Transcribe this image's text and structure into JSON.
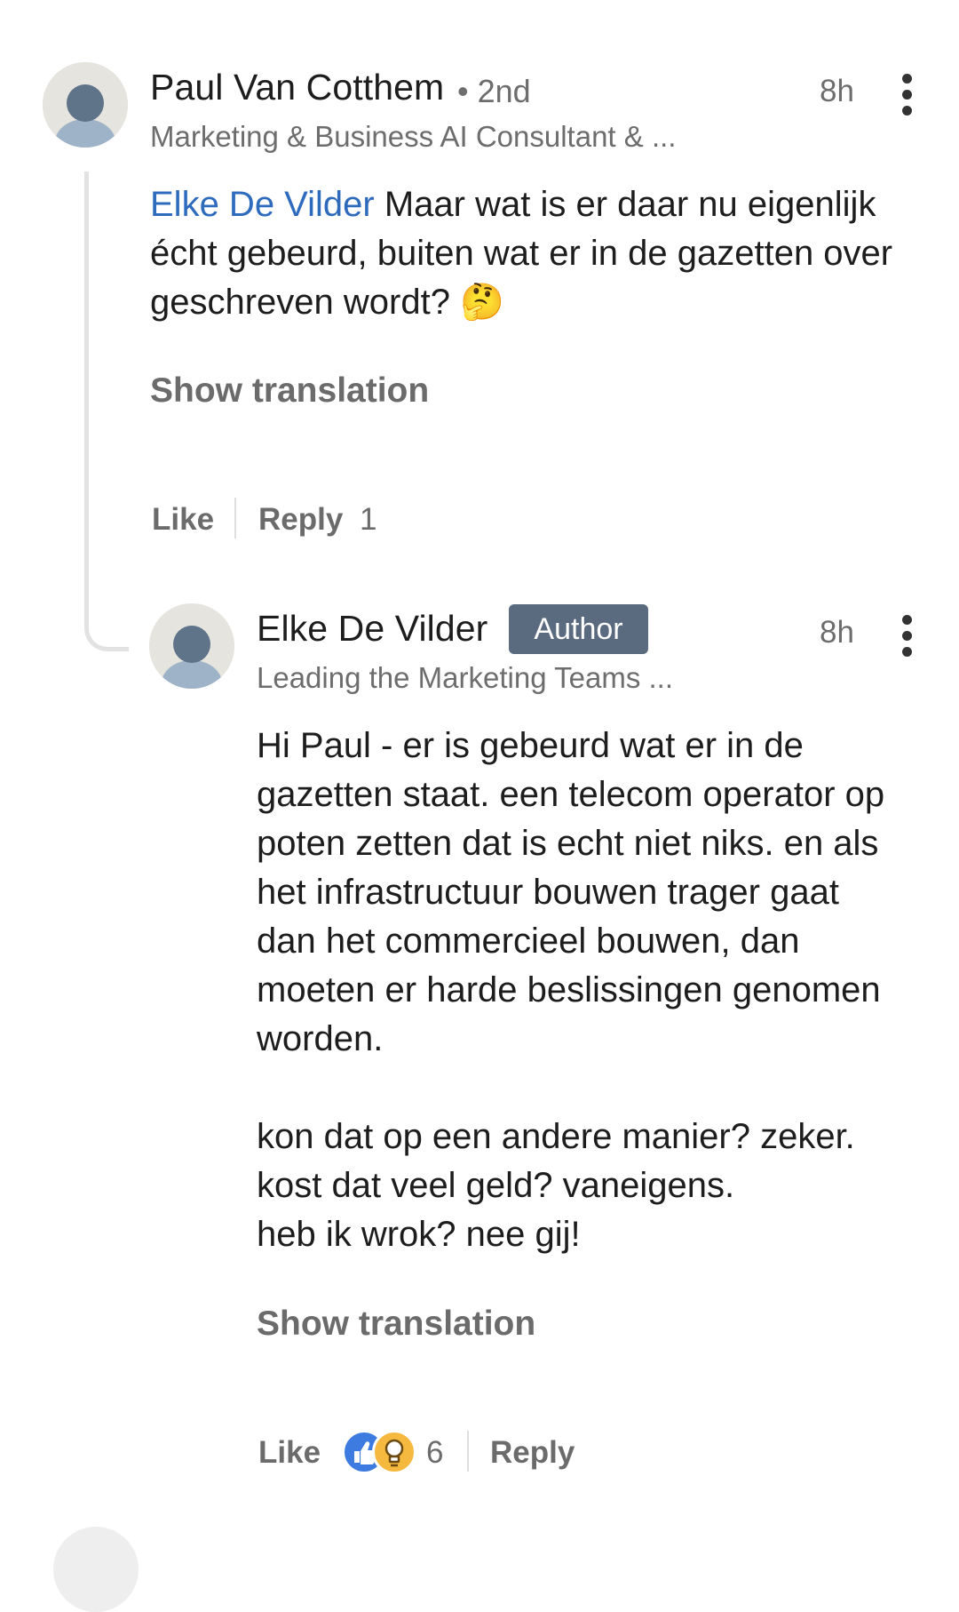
{
  "comments": [
    {
      "author": "Paul Van Cotthem",
      "degree": "• 2nd",
      "headline": "Marketing & Business AI Consultant & ...",
      "time": "8h",
      "mention": "Elke De Vilder",
      "text_line1": "Maar wat is er daar nu eigenlijk",
      "text_line2": "écht gebeurd, buiten wat er in de gazetten over",
      "text_line3": "geschreven wordt?",
      "emoji": "🤔",
      "show_translation": "Show translation",
      "like_label": "Like",
      "reply_label": "Reply",
      "reply_count": "1"
    },
    {
      "author": "Elke De Vilder",
      "badge": "Author",
      "headline": "Leading the Marketing Teams ...",
      "time": "8h",
      "lines": [
        "Hi Paul - er is gebeurd wat er in de",
        "gazetten staat. een telecom operator op",
        "poten zetten dat is echt niet niks. en als",
        "het infrastructuur bouwen trager gaat",
        "dan het commercieel bouwen, dan",
        "moeten er harde beslissingen genomen",
        "worden.",
        "",
        "kon dat op een andere manier? zeker.",
        "kost dat veel geld? vaneigens.",
        "heb ik wrok? nee gij!"
      ],
      "show_translation": "Show translation",
      "like_label": "Like",
      "reaction_count": "6",
      "reply_label": "Reply",
      "reactions": [
        "like-icon",
        "insightful-icon"
      ]
    }
  ],
  "colors": {
    "mention": "#2e6bbd",
    "badge": "#5a6a7f",
    "like_reaction": "#3d7be0",
    "insightful_reaction": "#f4b93e"
  }
}
